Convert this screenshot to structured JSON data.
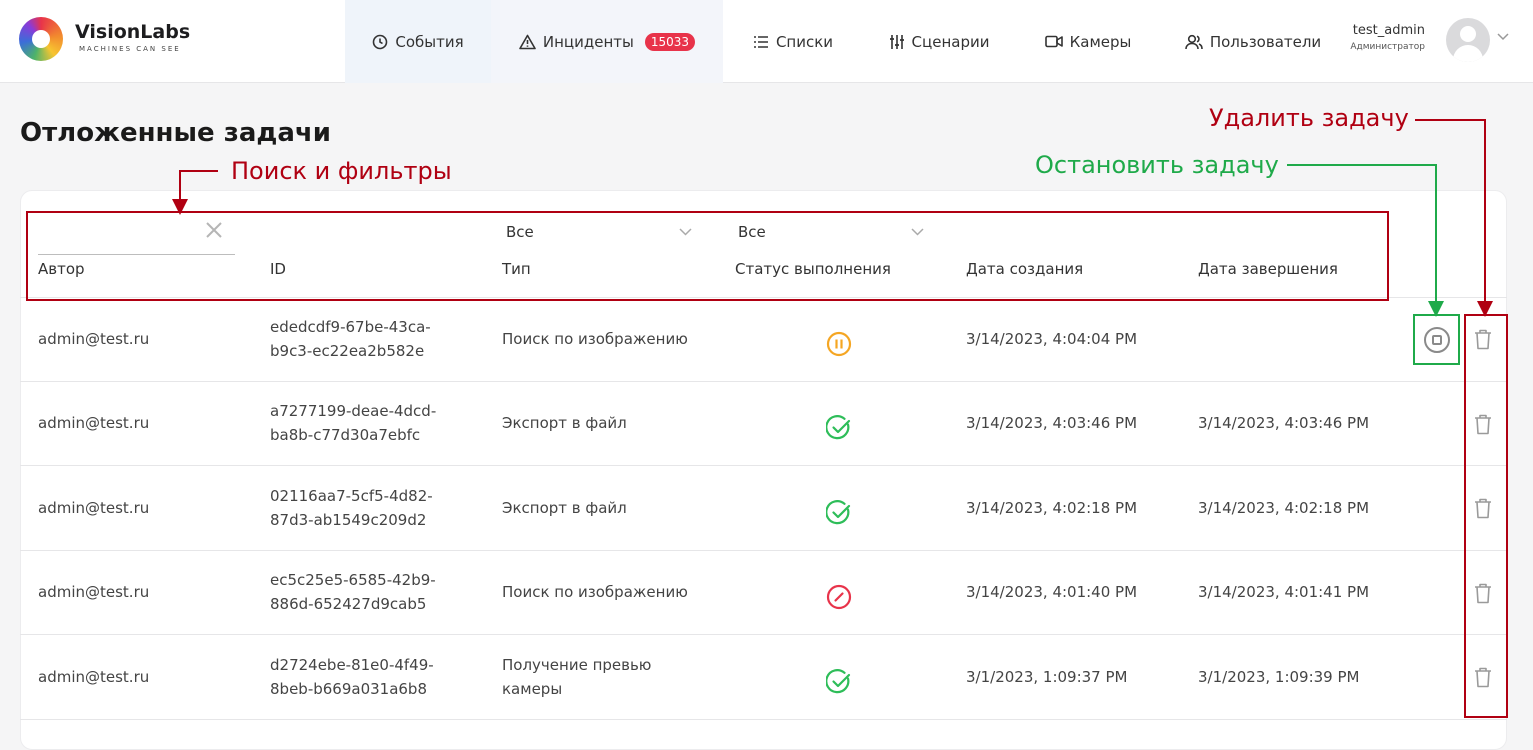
{
  "brand": {
    "name": "VisionLabs",
    "tagline": "MACHINES CAN SEE"
  },
  "nav": {
    "events": "События",
    "incidents": "Инциденты",
    "incidents_count": "15033",
    "lists": "Списки",
    "scenarios": "Сценарии",
    "cameras": "Камеры",
    "users": "Пользователи"
  },
  "user": {
    "name": "test_admin",
    "role": "Администратор"
  },
  "page": {
    "title": "Отложенные задачи"
  },
  "filters": {
    "author_value": "",
    "type_select": "Все",
    "status_select": "Все"
  },
  "columns": {
    "author": "Автор",
    "id": "ID",
    "type": "Тип",
    "status": "Статус выполнения",
    "created": "Дата создания",
    "finished": "Дата завершения"
  },
  "rows": [
    {
      "author": "admin@test.ru",
      "id": "ededcdf9-67be-43ca-b9c3-ec22ea2b582e",
      "type": "Поиск по изображению",
      "status": "paused",
      "created": "3/14/2023, 4:04:04 PM",
      "finished": ""
    },
    {
      "author": "admin@test.ru",
      "id": "a7277199-deae-4dcd-ba8b-c77d30a7ebfc",
      "type": "Экспорт в файл",
      "status": "done",
      "created": "3/14/2023, 4:03:46 PM",
      "finished": "3/14/2023, 4:03:46 PM"
    },
    {
      "author": "admin@test.ru",
      "id": "02116aa7-5cf5-4d82-87d3-ab1549c209d2",
      "type": "Экспорт в файл",
      "status": "done",
      "created": "3/14/2023, 4:02:18 PM",
      "finished": "3/14/2023, 4:02:18 PM"
    },
    {
      "author": "admin@test.ru",
      "id": "ec5c25e5-6585-42b9-886d-652427d9cab5",
      "type": "Поиск по изображению",
      "status": "failed",
      "created": "3/14/2023, 4:01:40 PM",
      "finished": "3/14/2023, 4:01:41 PM"
    },
    {
      "author": "admin@test.ru",
      "id": "d2724ebe-81e0-4f49-8beb-b669a031a6b8",
      "type": "Получение превью камеры",
      "status": "done",
      "created": "3/1/2023, 1:09:37 PM",
      "finished": "3/1/2023, 1:09:39 PM"
    }
  ],
  "annotations": {
    "filters": "Поиск и фильтры",
    "stop": "Остановить задачу",
    "delete": "Удалить задачу"
  },
  "colors": {
    "accent_red": "#b00012",
    "accent_green": "#1faa4a",
    "status_paused": "#f5a623",
    "status_done": "#2ebd59",
    "status_failed": "#e8334a",
    "badge": "#e8334a"
  },
  "icons": {
    "events": "clock-icon",
    "incidents": "warning-triangle-icon",
    "lists": "list-icon",
    "scenarios": "sliders-icon",
    "cameras": "video-camera-icon",
    "users": "users-icon",
    "delete": "trash-icon",
    "stop": "stop-circle-icon"
  }
}
